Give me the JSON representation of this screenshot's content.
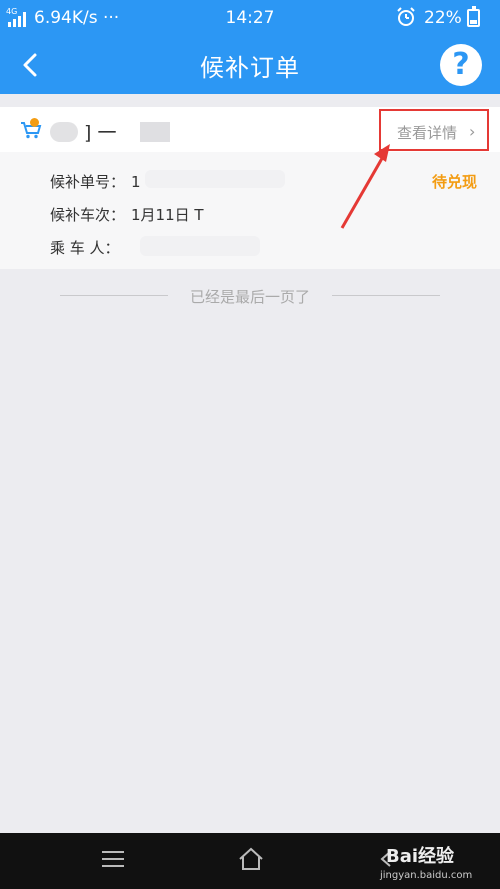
{
  "status_bar": {
    "network": "6.94K/s",
    "dots": "···",
    "time": "14:27",
    "battery": "22%",
    "signal": "4G"
  },
  "nav": {
    "title": "候补订单",
    "help": "?"
  },
  "order": {
    "route": "一",
    "detail_label": "查看详情",
    "detail_chevron": "›",
    "status": "待兑现",
    "fields": [
      {
        "label": "候补单号：",
        "value": "1"
      },
      {
        "label": "候补车次：",
        "value": "1月11日 T"
      },
      {
        "label": "乘 车 人：",
        "value": ""
      }
    ]
  },
  "end_note": "已经是最后一页了",
  "watermark": {
    "text": "Bai经验",
    "sub": "jingyan.baidu.com"
  },
  "colors": {
    "brand": "#2c97f4",
    "status": "#f39c12",
    "highlight": "#e53935"
  }
}
